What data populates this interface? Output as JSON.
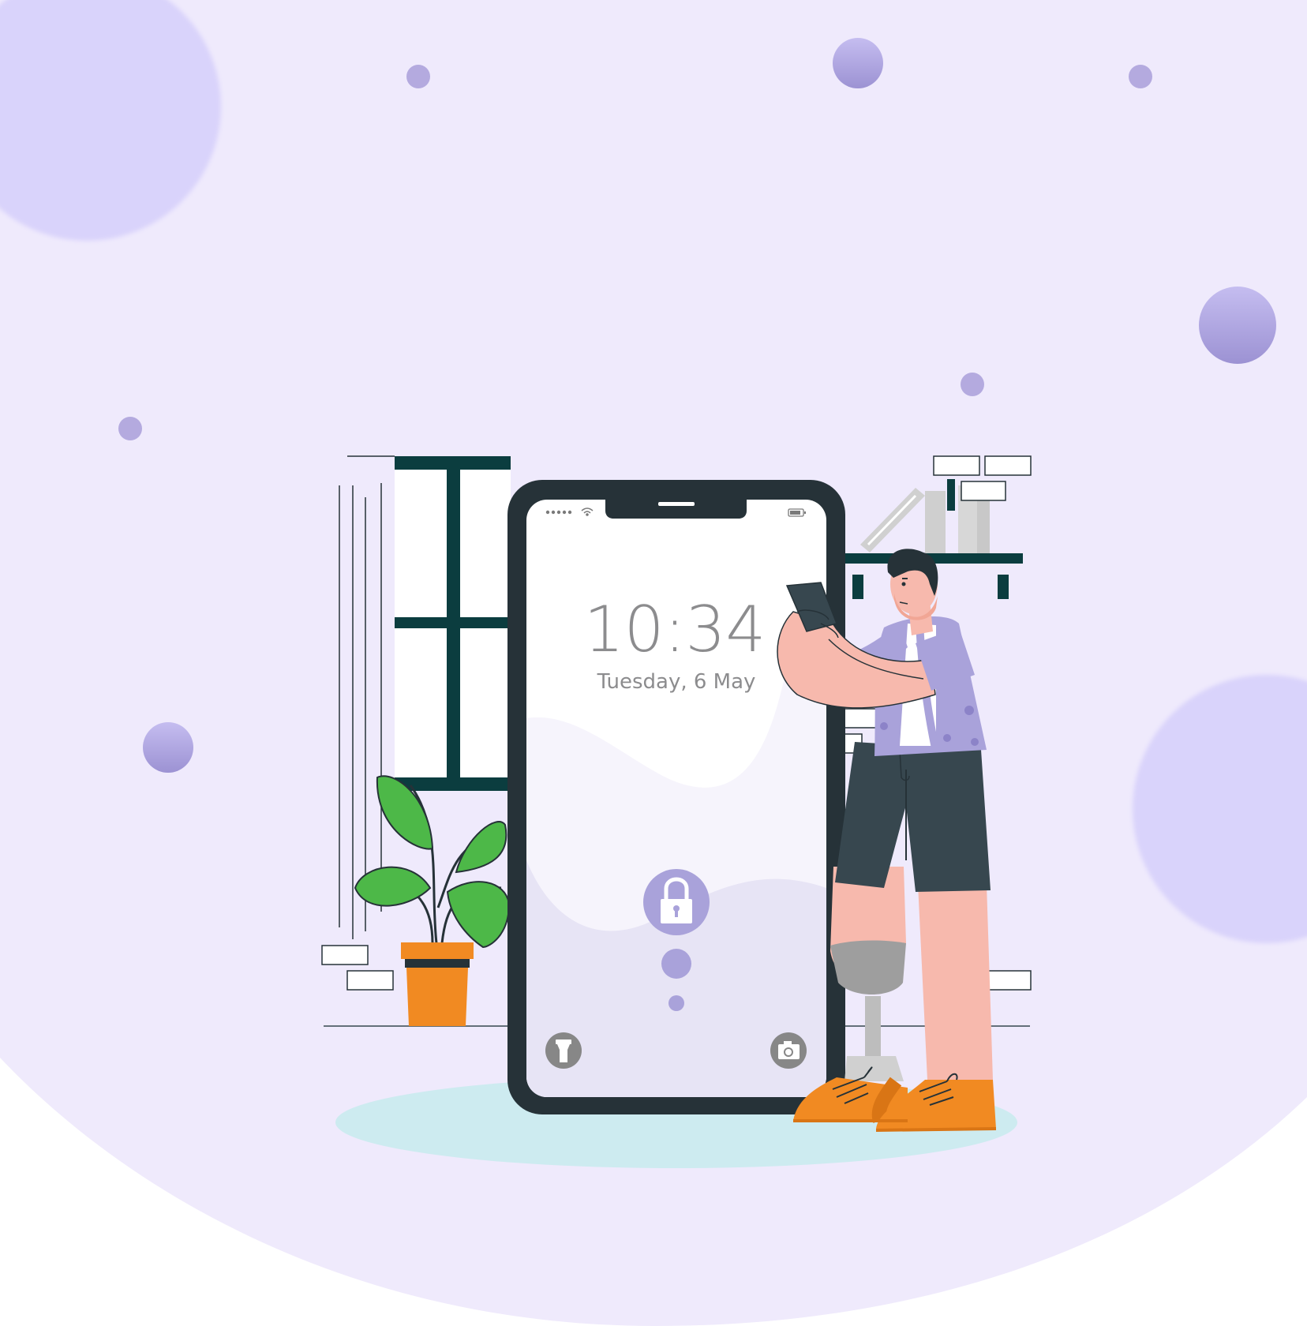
{
  "lockscreen": {
    "time": "10:34",
    "date": "Tuesday, 6 May",
    "lock_icon": "lock-icon",
    "flashlight_icon": "flashlight-icon",
    "camera_icon": "camera-icon",
    "signal_icon": "signal-dots-icon",
    "wifi_icon": "wifi-icon",
    "battery_icon": "battery-icon"
  },
  "colors": {
    "background": "#efeafc",
    "bubble": "#d9d3fb",
    "dot": "#a89ed8",
    "phone_frame": "#263238",
    "accent": "#a9a2da",
    "window_frame": "#0b3d3f",
    "pot": "#f18a22",
    "leaf": "#4db848",
    "shoes": "#f18a22",
    "skin": "#f7b9ad",
    "shirt": "#a9a2da",
    "shorts": "#37474f",
    "shadow": "#cdebf0"
  }
}
